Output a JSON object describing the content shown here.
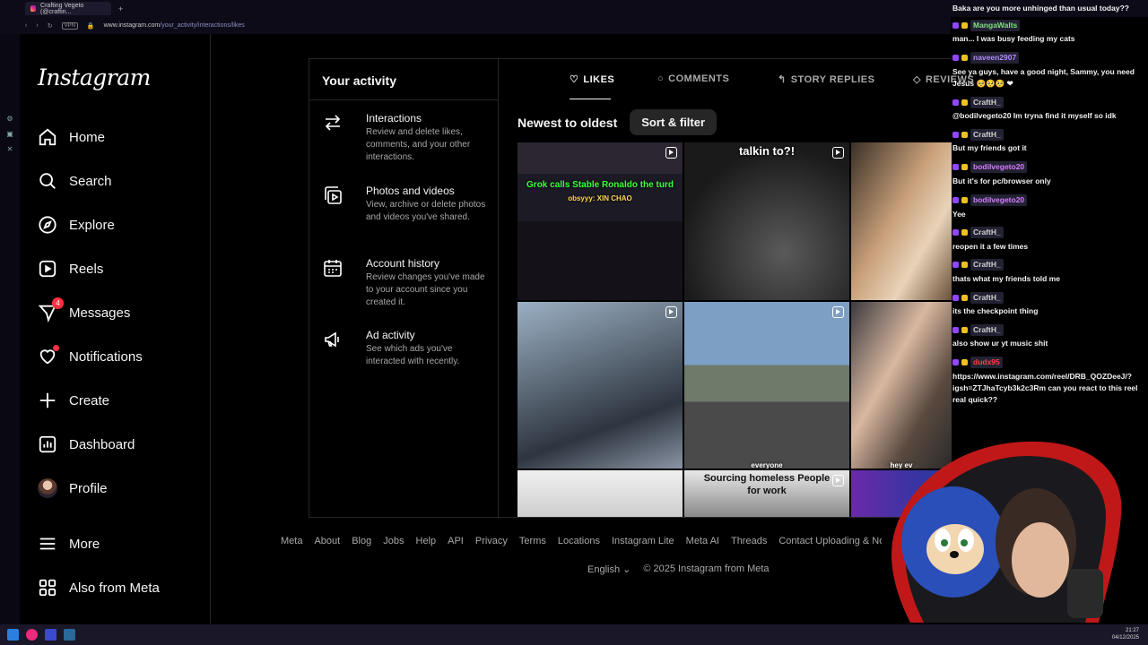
{
  "browser": {
    "tab_title": "Crafting Vegeto (@craftin...",
    "tab_plus": "+",
    "vpn_label": "VPN",
    "url_host": "www.instagram.com",
    "url_path": "/your_activity/interactions/likes"
  },
  "sidebar": {
    "logo": "Instagram",
    "items": [
      {
        "label": "Home",
        "icon": "home-icon"
      },
      {
        "label": "Search",
        "icon": "search-icon"
      },
      {
        "label": "Explore",
        "icon": "compass-icon"
      },
      {
        "label": "Reels",
        "icon": "reels-icon"
      },
      {
        "label": "Messages",
        "icon": "messenger-icon",
        "badge": "4"
      },
      {
        "label": "Notifications",
        "icon": "heart-icon"
      },
      {
        "label": "Create",
        "icon": "plus-icon"
      },
      {
        "label": "Dashboard",
        "icon": "dashboard-icon"
      },
      {
        "label": "Profile",
        "icon": "avatar"
      }
    ],
    "more": "More",
    "also_from_meta": "Also from Meta"
  },
  "activity": {
    "title": "Your activity",
    "items": [
      {
        "title": "Interactions",
        "desc": "Review and delete likes, comments, and your other interactions."
      },
      {
        "title": "Photos and videos",
        "desc": "View, archive or delete photos and videos you've shared."
      },
      {
        "title": "Account history",
        "desc": "Review changes you've made to your account since you created it."
      },
      {
        "title": "Ad activity",
        "desc": "See which ads you've interacted with recently."
      }
    ],
    "tabs": [
      "LIKES",
      "COMMENTS",
      "STORY REPLIES",
      "REVIEWS"
    ],
    "sort_label": "Newest to oldest",
    "sort_button": "Sort & filter",
    "tile_captions": {
      "t1": "Grok calls Stable Ronaldo the turd",
      "t1b": "obsyyy: XIN CHAO",
      "t2": "talkin to?!",
      "t7": "Sourcing homeless People for work",
      "t5": "everyone",
      "t6": "hey ev"
    }
  },
  "footer": {
    "links": [
      "Meta",
      "About",
      "Blog",
      "Jobs",
      "Help",
      "API",
      "Privacy",
      "Terms",
      "Locations",
      "Instagram Lite",
      "Meta AI",
      "Threads",
      "Contact Uploading & Non-Users"
    ],
    "language": "English",
    "copyright": "© 2025 Instagram from Meta"
  },
  "chat": [
    {
      "type": "msg",
      "text": "Baka are you more unhinged than usual today??"
    },
    {
      "type": "name",
      "name": "MangaWalts",
      "color": "#7ee07e"
    },
    {
      "type": "msg",
      "text": "man... I was busy feeding my cats"
    },
    {
      "type": "name",
      "name": "naveen2907",
      "color": "#b58cff"
    },
    {
      "type": "msg",
      "text": "See ya guys, have a good night, Sammy, you need Jesus 🥺🥺🥺 ❤"
    },
    {
      "type": "name",
      "name": "CraftH_",
      "color": "#d0d0d0"
    },
    {
      "type": "msg",
      "text": "@bodilvegeto20 Im tryna find it myself so idk"
    },
    {
      "type": "name",
      "name": "CraftH_",
      "color": "#d0d0d0"
    },
    {
      "type": "msg",
      "text": "But my friends got it"
    },
    {
      "type": "name",
      "name": "bodilvegeto20",
      "color": "#d77cff"
    },
    {
      "type": "msg",
      "text": "But it's for pc/browser only"
    },
    {
      "type": "name",
      "name": "bodilvegeto20",
      "color": "#d77cff"
    },
    {
      "type": "msg",
      "text": "Yee"
    },
    {
      "type": "name",
      "name": "CraftH_",
      "color": "#d0d0d0"
    },
    {
      "type": "msg",
      "text": "reopen it a few times"
    },
    {
      "type": "name",
      "name": "CraftH_",
      "color": "#d0d0d0"
    },
    {
      "type": "msg",
      "text": "thats what my friends told me"
    },
    {
      "type": "name",
      "name": "CraftH_",
      "color": "#d0d0d0"
    },
    {
      "type": "msg",
      "text": "its the checkpoint thing"
    },
    {
      "type": "name",
      "name": "CraftH_",
      "color": "#d0d0d0"
    },
    {
      "type": "msg",
      "text": "also show ur yt music shit"
    },
    {
      "type": "name",
      "name": "dudx95",
      "color": "#ff4040"
    },
    {
      "type": "msg",
      "text": "https://www.instagram.com/reel/DRB_QOZDeeJ/?igsh=ZTJhaTcyb3k2c3Rm can you react to this reel real quick??"
    }
  ],
  "taskbar": {
    "time": "21:27",
    "date": "04/12/2025"
  },
  "colors": {
    "bg": "#000000",
    "text": "#f5f5f5",
    "muted": "#a8a8a8",
    "border": "#262626",
    "badge": "#ff3040"
  }
}
